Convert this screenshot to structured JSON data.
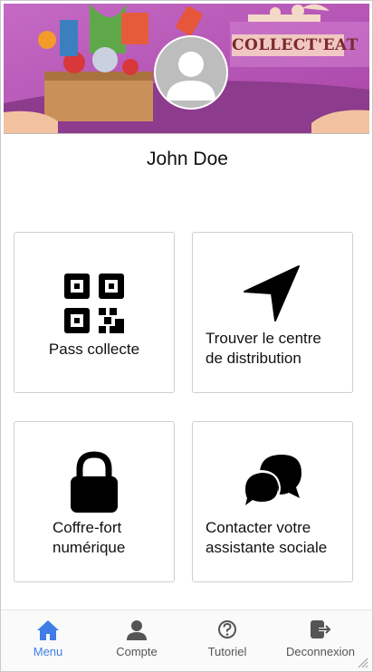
{
  "header": {
    "brand_text": "COLLECT'EAT",
    "user_name": "John Doe"
  },
  "cards": [
    {
      "label": "Pass collecte",
      "icon": "qr-code-icon"
    },
    {
      "label": "Trouver le centre de distribution",
      "icon": "navigation-arrow-icon"
    },
    {
      "label": "Coffre-fort numérique",
      "icon": "lock-icon"
    },
    {
      "label": "Contacter votre assistante sociale",
      "icon": "chat-bubbles-icon"
    }
  ],
  "nav": {
    "items": [
      {
        "label": "Menu",
        "icon": "home-icon",
        "active": true
      },
      {
        "label": "Compte",
        "icon": "user-icon",
        "active": false
      },
      {
        "label": "Tutoriel",
        "icon": "help-circle-icon",
        "active": false
      },
      {
        "label": "Deconnexion",
        "icon": "logout-icon",
        "active": false
      }
    ]
  },
  "colors": {
    "accent": "#3e7de6",
    "banner_purple": "#b24fae",
    "card_border": "#cfcfcf"
  }
}
